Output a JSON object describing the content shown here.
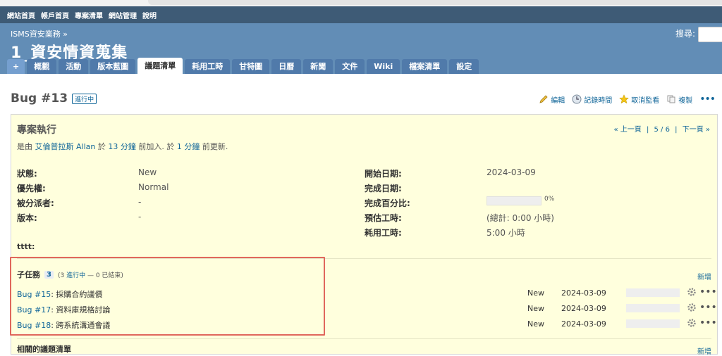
{
  "top_menu": [
    "網站首頁",
    "帳戶首頁",
    "專案清單",
    "網站管理",
    "說明"
  ],
  "header": {
    "breadcrumb": "ISMS資安業務 »",
    "project_title": "1_資安情資蒐集",
    "search_label": "搜尋:"
  },
  "tabs": [
    {
      "label": "+",
      "selected": false
    },
    {
      "label": "概觀",
      "selected": false
    },
    {
      "label": "活動",
      "selected": false
    },
    {
      "label": "版本藍圖",
      "selected": false
    },
    {
      "label": "議題清單",
      "selected": true
    },
    {
      "label": "耗用工時",
      "selected": false
    },
    {
      "label": "甘特圖",
      "selected": false
    },
    {
      "label": "日曆",
      "selected": false
    },
    {
      "label": "新聞",
      "selected": false
    },
    {
      "label": "文件",
      "selected": false
    },
    {
      "label": "Wiki",
      "selected": false
    },
    {
      "label": "檔案清單",
      "selected": false
    },
    {
      "label": "設定",
      "selected": false
    }
  ],
  "issue": {
    "title": "Bug #13",
    "status_badge": "進行中",
    "actions": {
      "edit": "編輯",
      "log_time": "記錄時間",
      "unwatch": "取消監看",
      "copy": "複製"
    },
    "subject": "專案執行",
    "nav": {
      "prev": "« 上一頁",
      "position": "5 / 6",
      "next": "下一頁 »",
      "sep": "|"
    },
    "author_line": {
      "prefix": "是由",
      "author": "艾倫普拉斯 Allan",
      "in": "於",
      "added_ago": "13 分鐘",
      "added_text": "前加入. 於",
      "updated_ago": "1 分鐘",
      "updated_text": "前更新."
    },
    "attributes_left": [
      {
        "label": "狀態:",
        "value": "New"
      },
      {
        "label": "優先權:",
        "value": "Normal"
      },
      {
        "label": "被分派者:",
        "value": "-"
      },
      {
        "label": "版本:",
        "value": "-"
      }
    ],
    "attributes_right": {
      "start_date_label": "開始日期:",
      "start_date": "2024-03-09",
      "due_date_label": "完成日期:",
      "due_date": "",
      "done_label": "完成百分比:",
      "done_ratio": "0%",
      "done_value": 0,
      "estimated_label": "預估工時:",
      "estimated": "(總計: 0:00 小時)",
      "spent_label": "耗用工時:",
      "spent": "5:00 小時"
    },
    "custom_field": "tttt:",
    "subtasks": {
      "title": "子任務",
      "count": "3",
      "summary_open": "(3",
      "summary_open_link": "進行中",
      "summary_rest": "— 0 已結束)",
      "add_label": "新增",
      "items": [
        {
          "id": "Bug #15",
          "subject": ": 採購合約議價",
          "status": "New",
          "date": "2024-03-09",
          "done": 0
        },
        {
          "id": "Bug #17",
          "subject": ": 資料庫規格討論",
          "status": "New",
          "date": "2024-03-09",
          "done": 0
        },
        {
          "id": "Bug #18",
          "subject": ": 跨系統溝通會議",
          "status": "New",
          "date": "2024-03-09",
          "done": 0
        }
      ]
    },
    "related_title": "相關的議題清單",
    "related_add": "新增"
  },
  "colors": {
    "header": "#628db6",
    "top_menu": "#3e5b76",
    "issue_bg": "#ffffdd",
    "link": "#116699",
    "highlight": "#e0675c"
  }
}
